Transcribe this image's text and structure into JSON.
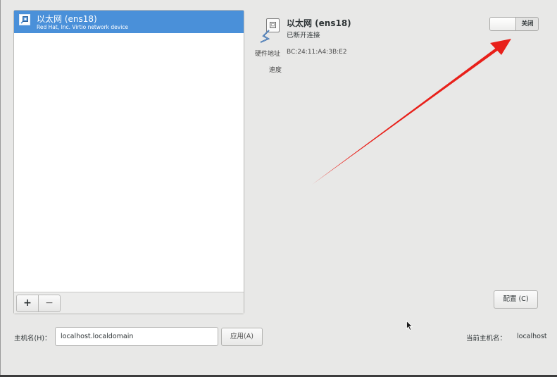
{
  "device_list": {
    "items": [
      {
        "title": "以太网 (ens18)",
        "subtitle": "Red Hat, Inc. Virtio network device",
        "icon": "network-device-icon",
        "selected": true
      }
    ],
    "add_label": "+",
    "remove_label": "−"
  },
  "device": {
    "title": "以太网 (ens18)",
    "status": "已断开连接",
    "hw_label": "硬件地址",
    "hw_address": "BC:24:11:A4:3B:E2",
    "speed_label": "速度",
    "toggle_label": "关闭",
    "toggle_on": false,
    "config_label": "配置 (C)",
    "icon": "ethernet-cable-icon"
  },
  "hostname": {
    "label": "主机名(H)：",
    "value": "localhost.localdomain",
    "apply_label": "应用(A)",
    "current_label": "当前主机名：",
    "current_value": "localhost"
  },
  "colors": {
    "selection": "#4a90d9",
    "annotation_arrow": "#e8201a",
    "background": "#e8e8e7"
  }
}
